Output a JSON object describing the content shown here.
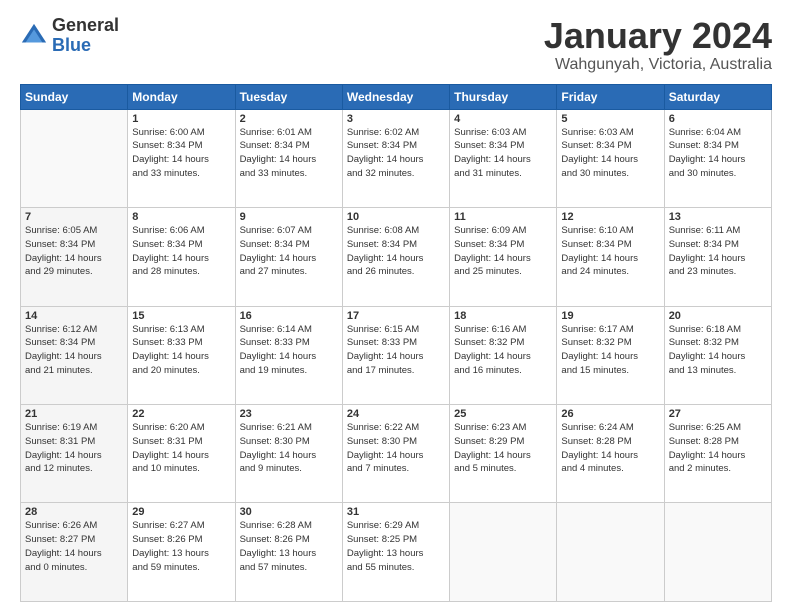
{
  "logo": {
    "general": "General",
    "blue": "Blue"
  },
  "title": {
    "main": "January 2024",
    "sub": "Wahgunyah, Victoria, Australia"
  },
  "weekdays": [
    "Sunday",
    "Monday",
    "Tuesday",
    "Wednesday",
    "Thursday",
    "Friday",
    "Saturday"
  ],
  "weeks": [
    [
      {
        "day": "",
        "info": ""
      },
      {
        "day": "1",
        "info": "Sunrise: 6:00 AM\nSunset: 8:34 PM\nDaylight: 14 hours\nand 33 minutes."
      },
      {
        "day": "2",
        "info": "Sunrise: 6:01 AM\nSunset: 8:34 PM\nDaylight: 14 hours\nand 33 minutes."
      },
      {
        "day": "3",
        "info": "Sunrise: 6:02 AM\nSunset: 8:34 PM\nDaylight: 14 hours\nand 32 minutes."
      },
      {
        "day": "4",
        "info": "Sunrise: 6:03 AM\nSunset: 8:34 PM\nDaylight: 14 hours\nand 31 minutes."
      },
      {
        "day": "5",
        "info": "Sunrise: 6:03 AM\nSunset: 8:34 PM\nDaylight: 14 hours\nand 30 minutes."
      },
      {
        "day": "6",
        "info": "Sunrise: 6:04 AM\nSunset: 8:34 PM\nDaylight: 14 hours\nand 30 minutes."
      }
    ],
    [
      {
        "day": "7",
        "info": "Sunrise: 6:05 AM\nSunset: 8:34 PM\nDaylight: 14 hours\nand 29 minutes."
      },
      {
        "day": "8",
        "info": "Sunrise: 6:06 AM\nSunset: 8:34 PM\nDaylight: 14 hours\nand 28 minutes."
      },
      {
        "day": "9",
        "info": "Sunrise: 6:07 AM\nSunset: 8:34 PM\nDaylight: 14 hours\nand 27 minutes."
      },
      {
        "day": "10",
        "info": "Sunrise: 6:08 AM\nSunset: 8:34 PM\nDaylight: 14 hours\nand 26 minutes."
      },
      {
        "day": "11",
        "info": "Sunrise: 6:09 AM\nSunset: 8:34 PM\nDaylight: 14 hours\nand 25 minutes."
      },
      {
        "day": "12",
        "info": "Sunrise: 6:10 AM\nSunset: 8:34 PM\nDaylight: 14 hours\nand 24 minutes."
      },
      {
        "day": "13",
        "info": "Sunrise: 6:11 AM\nSunset: 8:34 PM\nDaylight: 14 hours\nand 23 minutes."
      }
    ],
    [
      {
        "day": "14",
        "info": "Sunrise: 6:12 AM\nSunset: 8:34 PM\nDaylight: 14 hours\nand 21 minutes."
      },
      {
        "day": "15",
        "info": "Sunrise: 6:13 AM\nSunset: 8:33 PM\nDaylight: 14 hours\nand 20 minutes."
      },
      {
        "day": "16",
        "info": "Sunrise: 6:14 AM\nSunset: 8:33 PM\nDaylight: 14 hours\nand 19 minutes."
      },
      {
        "day": "17",
        "info": "Sunrise: 6:15 AM\nSunset: 8:33 PM\nDaylight: 14 hours\nand 17 minutes."
      },
      {
        "day": "18",
        "info": "Sunrise: 6:16 AM\nSunset: 8:32 PM\nDaylight: 14 hours\nand 16 minutes."
      },
      {
        "day": "19",
        "info": "Sunrise: 6:17 AM\nSunset: 8:32 PM\nDaylight: 14 hours\nand 15 minutes."
      },
      {
        "day": "20",
        "info": "Sunrise: 6:18 AM\nSunset: 8:32 PM\nDaylight: 14 hours\nand 13 minutes."
      }
    ],
    [
      {
        "day": "21",
        "info": "Sunrise: 6:19 AM\nSunset: 8:31 PM\nDaylight: 14 hours\nand 12 minutes."
      },
      {
        "day": "22",
        "info": "Sunrise: 6:20 AM\nSunset: 8:31 PM\nDaylight: 14 hours\nand 10 minutes."
      },
      {
        "day": "23",
        "info": "Sunrise: 6:21 AM\nSunset: 8:30 PM\nDaylight: 14 hours\nand 9 minutes."
      },
      {
        "day": "24",
        "info": "Sunrise: 6:22 AM\nSunset: 8:30 PM\nDaylight: 14 hours\nand 7 minutes."
      },
      {
        "day": "25",
        "info": "Sunrise: 6:23 AM\nSunset: 8:29 PM\nDaylight: 14 hours\nand 5 minutes."
      },
      {
        "day": "26",
        "info": "Sunrise: 6:24 AM\nSunset: 8:28 PM\nDaylight: 14 hours\nand 4 minutes."
      },
      {
        "day": "27",
        "info": "Sunrise: 6:25 AM\nSunset: 8:28 PM\nDaylight: 14 hours\nand 2 minutes."
      }
    ],
    [
      {
        "day": "28",
        "info": "Sunrise: 6:26 AM\nSunset: 8:27 PM\nDaylight: 14 hours\nand 0 minutes."
      },
      {
        "day": "29",
        "info": "Sunrise: 6:27 AM\nSunset: 8:26 PM\nDaylight: 13 hours\nand 59 minutes."
      },
      {
        "day": "30",
        "info": "Sunrise: 6:28 AM\nSunset: 8:26 PM\nDaylight: 13 hours\nand 57 minutes."
      },
      {
        "day": "31",
        "info": "Sunrise: 6:29 AM\nSunset: 8:25 PM\nDaylight: 13 hours\nand 55 minutes."
      },
      {
        "day": "",
        "info": ""
      },
      {
        "day": "",
        "info": ""
      },
      {
        "day": "",
        "info": ""
      }
    ]
  ]
}
